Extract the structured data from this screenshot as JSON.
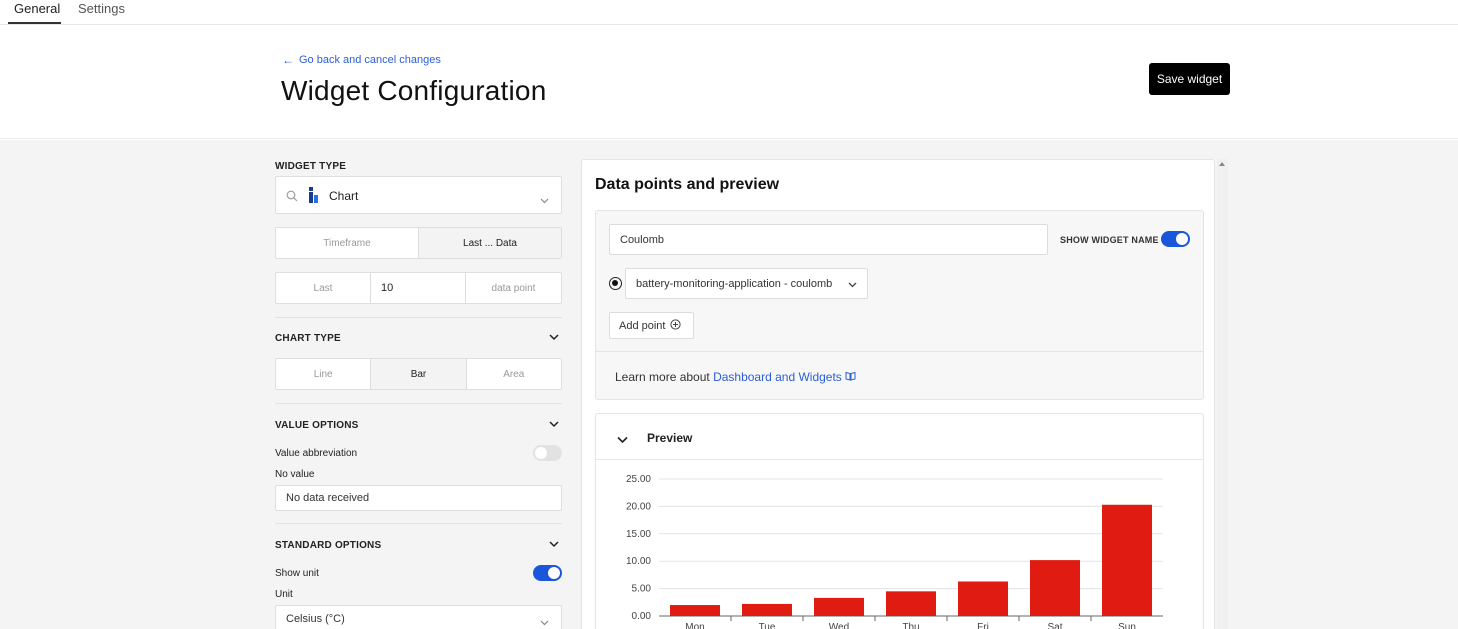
{
  "tabs": [
    {
      "label": "General"
    },
    {
      "label": "Settings"
    }
  ],
  "header": {
    "back_label": "Go back and cancel changes",
    "title": "Widget Configuration",
    "save_label": "Save widget"
  },
  "left": {
    "widget_type": {
      "label": "WIDGET TYPE",
      "selected": "Chart",
      "icon": "chart-type-icon"
    },
    "timeframe": {
      "options": [
        {
          "label": "Timeframe",
          "active": false
        },
        {
          "label": "Last ... Data",
          "active": true
        }
      ]
    },
    "last_n": {
      "prefix": "Last",
      "value": "10",
      "suffix": "data point"
    },
    "chart_type": {
      "label": "CHART TYPE",
      "options": [
        {
          "label": "Line",
          "active": false
        },
        {
          "label": "Bar",
          "active": true
        },
        {
          "label": "Area",
          "active": false
        }
      ]
    },
    "value_options": {
      "label": "VALUE OPTIONS",
      "abbreviation_label": "Value abbreviation",
      "abbreviation_on": false,
      "no_value_label": "No value",
      "no_value_value": "No data received"
    },
    "standard_options": {
      "label": "STANDARD OPTIONS",
      "show_unit_label": "Show unit",
      "show_unit_on": true,
      "unit_label": "Unit",
      "unit_value": "Celsius (°C)"
    }
  },
  "right": {
    "title": "Data points and preview",
    "widget_name_value": "Coulomb",
    "show_widget_name_label": "SHOW WIDGET NAME",
    "show_widget_name_on": true,
    "datasource_value": "battery-monitoring-application - coulomb",
    "add_point_label": "Add point",
    "learn_prefix": "Learn more about ",
    "learn_link": "Dashboard and Widgets",
    "preview_label": "Preview"
  },
  "colors": {
    "accent": "#1a56db",
    "link": "#2b5fd6",
    "bar": "#e01b12"
  },
  "chart_data": {
    "type": "bar",
    "categories": [
      "Mon",
      "Tue",
      "Wed",
      "Thu",
      "Fri",
      "Sat",
      "Sun"
    ],
    "values": [
      2,
      2.2,
      3.3,
      4.5,
      6.3,
      10.2,
      20.3
    ],
    "yticks": [
      "0.00",
      "5.00",
      "10.00",
      "15.00",
      "20.00",
      "25.00"
    ],
    "ylim": [
      0,
      25
    ],
    "grid": true
  }
}
